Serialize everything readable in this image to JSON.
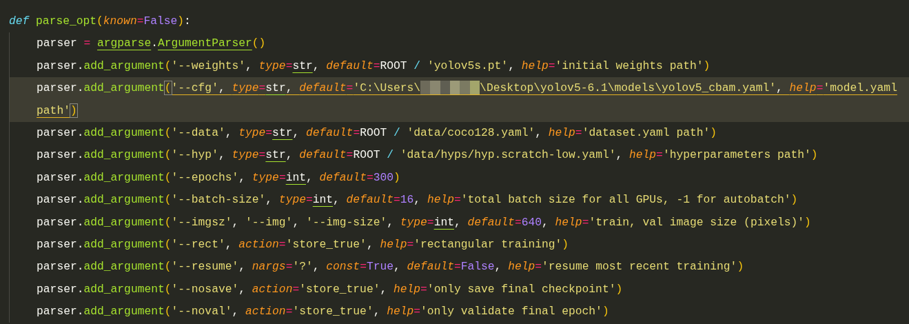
{
  "lines": [
    {
      "kind": "def",
      "current": false,
      "tokens": [
        {
          "t": "def ",
          "kind": "kw"
        },
        {
          "t": "parse_opt",
          "kind": "fn"
        },
        {
          "t": "(",
          "kind": "paren"
        },
        {
          "t": "known",
          "kind": "param"
        },
        {
          "t": "=",
          "kind": "op"
        },
        {
          "t": "False",
          "kind": "const"
        },
        {
          "t": ")",
          "kind": "paren"
        },
        {
          "t": ":",
          "kind": "plain"
        }
      ]
    },
    {
      "kind": "stmt",
      "current": false,
      "tokens": [
        {
          "t": "parser ",
          "kind": "plain"
        },
        {
          "t": "= ",
          "kind": "op"
        },
        {
          "t": "argparse",
          "kind": "fn",
          "underlined": true
        },
        {
          "t": ".",
          "kind": "plain"
        },
        {
          "t": "ArgumentParser",
          "kind": "fn",
          "underlined": true
        },
        {
          "t": "()",
          "kind": "paren"
        }
      ]
    },
    {
      "kind": "stmt",
      "current": false,
      "tokens": [
        {
          "t": "parser.",
          "kind": "plain"
        },
        {
          "t": "add_argument",
          "kind": "fn"
        },
        {
          "t": "(",
          "kind": "paren"
        },
        {
          "t": "'--weights'",
          "kind": "str"
        },
        {
          "t": ", ",
          "kind": "plain"
        },
        {
          "t": "type",
          "kind": "param"
        },
        {
          "t": "=",
          "kind": "op"
        },
        {
          "t": "str",
          "kind": "type",
          "underlined": true
        },
        {
          "t": ", ",
          "kind": "plain"
        },
        {
          "t": "default",
          "kind": "param"
        },
        {
          "t": "=",
          "kind": "op"
        },
        {
          "t": "ROOT ",
          "kind": "plain"
        },
        {
          "t": "/ ",
          "kind": "slash"
        },
        {
          "t": "'yolov5s.pt'",
          "kind": "str"
        },
        {
          "t": ", ",
          "kind": "plain"
        },
        {
          "t": "help",
          "kind": "param"
        },
        {
          "t": "=",
          "kind": "op"
        },
        {
          "t": "'initial weights path'",
          "kind": "str"
        },
        {
          "t": ")",
          "kind": "paren"
        }
      ]
    },
    {
      "kind": "stmt",
      "current": true,
      "tokens": [
        {
          "t": "parser.",
          "kind": "plain"
        },
        {
          "t": "add_argument",
          "kind": "fn"
        },
        {
          "t": "(",
          "kind": "paren",
          "box": true
        },
        {
          "t": "'--cfg'",
          "kind": "str",
          "warning": true
        },
        {
          "t": ", ",
          "kind": "plain",
          "warning": true
        },
        {
          "t": "type",
          "kind": "param",
          "warning": true
        },
        {
          "t": "=",
          "kind": "op",
          "warning": true
        },
        {
          "t": "str",
          "kind": "type",
          "underlined": true
        },
        {
          "t": ", ",
          "kind": "plain",
          "warning": true
        },
        {
          "t": "default",
          "kind": "param",
          "warning": true
        },
        {
          "t": "=",
          "kind": "op",
          "warning": true
        },
        {
          "t": "'C:\\Users\\",
          "kind": "str",
          "warning": true
        },
        {
          "kind": "blur",
          "warning": true
        },
        {
          "t": "\\Desktop\\yolov5-6.1\\models\\yolov5_cbam.yaml'",
          "kind": "str",
          "warning": true
        },
        {
          "t": ", ",
          "kind": "plain",
          "warning": true
        },
        {
          "t": "help",
          "kind": "param",
          "warning": true
        },
        {
          "t": "=",
          "kind": "op",
          "warning": true
        },
        {
          "t": "'model.yaml",
          "kind": "str",
          "warning": true
        }
      ]
    },
    {
      "kind": "wrap",
      "current": true,
      "tokens": [
        {
          "t": "path'",
          "kind": "str",
          "warning": true
        },
        {
          "t": ")",
          "kind": "paren",
          "box": true
        }
      ]
    },
    {
      "kind": "stmt",
      "current": false,
      "tokens": [
        {
          "t": "parser.",
          "kind": "plain"
        },
        {
          "t": "add_argument",
          "kind": "fn"
        },
        {
          "t": "(",
          "kind": "paren"
        },
        {
          "t": "'--data'",
          "kind": "str"
        },
        {
          "t": ", ",
          "kind": "plain"
        },
        {
          "t": "type",
          "kind": "param"
        },
        {
          "t": "=",
          "kind": "op"
        },
        {
          "t": "str",
          "kind": "type",
          "underlined": true
        },
        {
          "t": ", ",
          "kind": "plain"
        },
        {
          "t": "default",
          "kind": "param"
        },
        {
          "t": "=",
          "kind": "op"
        },
        {
          "t": "ROOT ",
          "kind": "plain"
        },
        {
          "t": "/ ",
          "kind": "slash"
        },
        {
          "t": "'data/coco128.yaml'",
          "kind": "str"
        },
        {
          "t": ", ",
          "kind": "plain"
        },
        {
          "t": "help",
          "kind": "param"
        },
        {
          "t": "=",
          "kind": "op"
        },
        {
          "t": "'dataset.yaml path'",
          "kind": "str"
        },
        {
          "t": ")",
          "kind": "paren"
        }
      ]
    },
    {
      "kind": "stmt",
      "current": false,
      "tokens": [
        {
          "t": "parser.",
          "kind": "plain"
        },
        {
          "t": "add_argument",
          "kind": "fn"
        },
        {
          "t": "(",
          "kind": "paren"
        },
        {
          "t": "'--hyp'",
          "kind": "str"
        },
        {
          "t": ", ",
          "kind": "plain"
        },
        {
          "t": "type",
          "kind": "param"
        },
        {
          "t": "=",
          "kind": "op"
        },
        {
          "t": "str",
          "kind": "type",
          "underlined": true
        },
        {
          "t": ", ",
          "kind": "plain"
        },
        {
          "t": "default",
          "kind": "param"
        },
        {
          "t": "=",
          "kind": "op"
        },
        {
          "t": "ROOT ",
          "kind": "plain"
        },
        {
          "t": "/ ",
          "kind": "slash"
        },
        {
          "t": "'data/hyps/hyp.scratch-low.yaml'",
          "kind": "str"
        },
        {
          "t": ", ",
          "kind": "plain"
        },
        {
          "t": "help",
          "kind": "param"
        },
        {
          "t": "=",
          "kind": "op"
        },
        {
          "t": "'hyperparameters path'",
          "kind": "str"
        },
        {
          "t": ")",
          "kind": "paren"
        }
      ]
    },
    {
      "kind": "stmt",
      "current": false,
      "tokens": [
        {
          "t": "parser.",
          "kind": "plain"
        },
        {
          "t": "add_argument",
          "kind": "fn"
        },
        {
          "t": "(",
          "kind": "paren"
        },
        {
          "t": "'--epochs'",
          "kind": "str"
        },
        {
          "t": ", ",
          "kind": "plain"
        },
        {
          "t": "type",
          "kind": "param"
        },
        {
          "t": "=",
          "kind": "op"
        },
        {
          "t": "int",
          "kind": "type",
          "underlined": true
        },
        {
          "t": ", ",
          "kind": "plain"
        },
        {
          "t": "default",
          "kind": "param"
        },
        {
          "t": "=",
          "kind": "op"
        },
        {
          "t": "300",
          "kind": "const"
        },
        {
          "t": ")",
          "kind": "paren"
        }
      ]
    },
    {
      "kind": "stmt",
      "current": false,
      "tokens": [
        {
          "t": "parser.",
          "kind": "plain"
        },
        {
          "t": "add_argument",
          "kind": "fn"
        },
        {
          "t": "(",
          "kind": "paren"
        },
        {
          "t": "'--batch-size'",
          "kind": "str"
        },
        {
          "t": ", ",
          "kind": "plain"
        },
        {
          "t": "type",
          "kind": "param"
        },
        {
          "t": "=",
          "kind": "op"
        },
        {
          "t": "int",
          "kind": "type",
          "underlined": true
        },
        {
          "t": ", ",
          "kind": "plain"
        },
        {
          "t": "default",
          "kind": "param"
        },
        {
          "t": "=",
          "kind": "op"
        },
        {
          "t": "16",
          "kind": "const"
        },
        {
          "t": ", ",
          "kind": "plain"
        },
        {
          "t": "help",
          "kind": "param"
        },
        {
          "t": "=",
          "kind": "op"
        },
        {
          "t": "'total batch size for all GPUs, -1 for autobatch'",
          "kind": "str"
        },
        {
          "t": ")",
          "kind": "paren"
        }
      ]
    },
    {
      "kind": "stmt",
      "current": false,
      "tokens": [
        {
          "t": "parser.",
          "kind": "plain"
        },
        {
          "t": "add_argument",
          "kind": "fn"
        },
        {
          "t": "(",
          "kind": "paren"
        },
        {
          "t": "'--imgsz'",
          "kind": "str"
        },
        {
          "t": ", ",
          "kind": "plain"
        },
        {
          "t": "'--img'",
          "kind": "str"
        },
        {
          "t": ", ",
          "kind": "plain"
        },
        {
          "t": "'--img-size'",
          "kind": "str"
        },
        {
          "t": ", ",
          "kind": "plain"
        },
        {
          "t": "type",
          "kind": "param"
        },
        {
          "t": "=",
          "kind": "op"
        },
        {
          "t": "int",
          "kind": "type",
          "underlined": true
        },
        {
          "t": ", ",
          "kind": "plain"
        },
        {
          "t": "default",
          "kind": "param"
        },
        {
          "t": "=",
          "kind": "op"
        },
        {
          "t": "640",
          "kind": "const"
        },
        {
          "t": ", ",
          "kind": "plain"
        },
        {
          "t": "help",
          "kind": "param"
        },
        {
          "t": "=",
          "kind": "op"
        },
        {
          "t": "'train, val image size (pixels)'",
          "kind": "str"
        },
        {
          "t": ")",
          "kind": "paren"
        }
      ]
    },
    {
      "kind": "stmt",
      "current": false,
      "tokens": [
        {
          "t": "parser.",
          "kind": "plain"
        },
        {
          "t": "add_argument",
          "kind": "fn"
        },
        {
          "t": "(",
          "kind": "paren"
        },
        {
          "t": "'--rect'",
          "kind": "str"
        },
        {
          "t": ", ",
          "kind": "plain"
        },
        {
          "t": "action",
          "kind": "param"
        },
        {
          "t": "=",
          "kind": "op"
        },
        {
          "t": "'store_true'",
          "kind": "str"
        },
        {
          "t": ", ",
          "kind": "plain"
        },
        {
          "t": "help",
          "kind": "param"
        },
        {
          "t": "=",
          "kind": "op"
        },
        {
          "t": "'rectangular training'",
          "kind": "str"
        },
        {
          "t": ")",
          "kind": "paren"
        }
      ]
    },
    {
      "kind": "stmt",
      "current": false,
      "tokens": [
        {
          "t": "parser.",
          "kind": "plain"
        },
        {
          "t": "add_argument",
          "kind": "fn"
        },
        {
          "t": "(",
          "kind": "paren"
        },
        {
          "t": "'--resume'",
          "kind": "str"
        },
        {
          "t": ", ",
          "kind": "plain"
        },
        {
          "t": "nargs",
          "kind": "param"
        },
        {
          "t": "=",
          "kind": "op"
        },
        {
          "t": "'?'",
          "kind": "str"
        },
        {
          "t": ", ",
          "kind": "plain"
        },
        {
          "t": "const",
          "kind": "param"
        },
        {
          "t": "=",
          "kind": "op"
        },
        {
          "t": "True",
          "kind": "const"
        },
        {
          "t": ", ",
          "kind": "plain"
        },
        {
          "t": "default",
          "kind": "param"
        },
        {
          "t": "=",
          "kind": "op"
        },
        {
          "t": "False",
          "kind": "const"
        },
        {
          "t": ", ",
          "kind": "plain"
        },
        {
          "t": "help",
          "kind": "param"
        },
        {
          "t": "=",
          "kind": "op"
        },
        {
          "t": "'resume most recent training'",
          "kind": "str"
        },
        {
          "t": ")",
          "kind": "paren"
        }
      ]
    },
    {
      "kind": "stmt",
      "current": false,
      "tokens": [
        {
          "t": "parser.",
          "kind": "plain"
        },
        {
          "t": "add_argument",
          "kind": "fn"
        },
        {
          "t": "(",
          "kind": "paren"
        },
        {
          "t": "'--nosave'",
          "kind": "str"
        },
        {
          "t": ", ",
          "kind": "plain"
        },
        {
          "t": "action",
          "kind": "param"
        },
        {
          "t": "=",
          "kind": "op"
        },
        {
          "t": "'store_true'",
          "kind": "str"
        },
        {
          "t": ", ",
          "kind": "plain"
        },
        {
          "t": "help",
          "kind": "param"
        },
        {
          "t": "=",
          "kind": "op"
        },
        {
          "t": "'only save final checkpoint'",
          "kind": "str"
        },
        {
          "t": ")",
          "kind": "paren"
        }
      ]
    },
    {
      "kind": "stmt",
      "current": false,
      "tokens": [
        {
          "t": "parser.",
          "kind": "plain"
        },
        {
          "t": "add_argument",
          "kind": "fn"
        },
        {
          "t": "(",
          "kind": "paren"
        },
        {
          "t": "'--noval'",
          "kind": "str"
        },
        {
          "t": ", ",
          "kind": "plain"
        },
        {
          "t": "action",
          "kind": "param"
        },
        {
          "t": "=",
          "kind": "op"
        },
        {
          "t": "'store_true'",
          "kind": "str"
        },
        {
          "t": ", ",
          "kind": "plain"
        },
        {
          "t": "help",
          "kind": "param"
        },
        {
          "t": "=",
          "kind": "op"
        },
        {
          "t": "'only validate final epoch'",
          "kind": "str"
        },
        {
          "t": ")",
          "kind": "paren"
        }
      ]
    }
  ]
}
